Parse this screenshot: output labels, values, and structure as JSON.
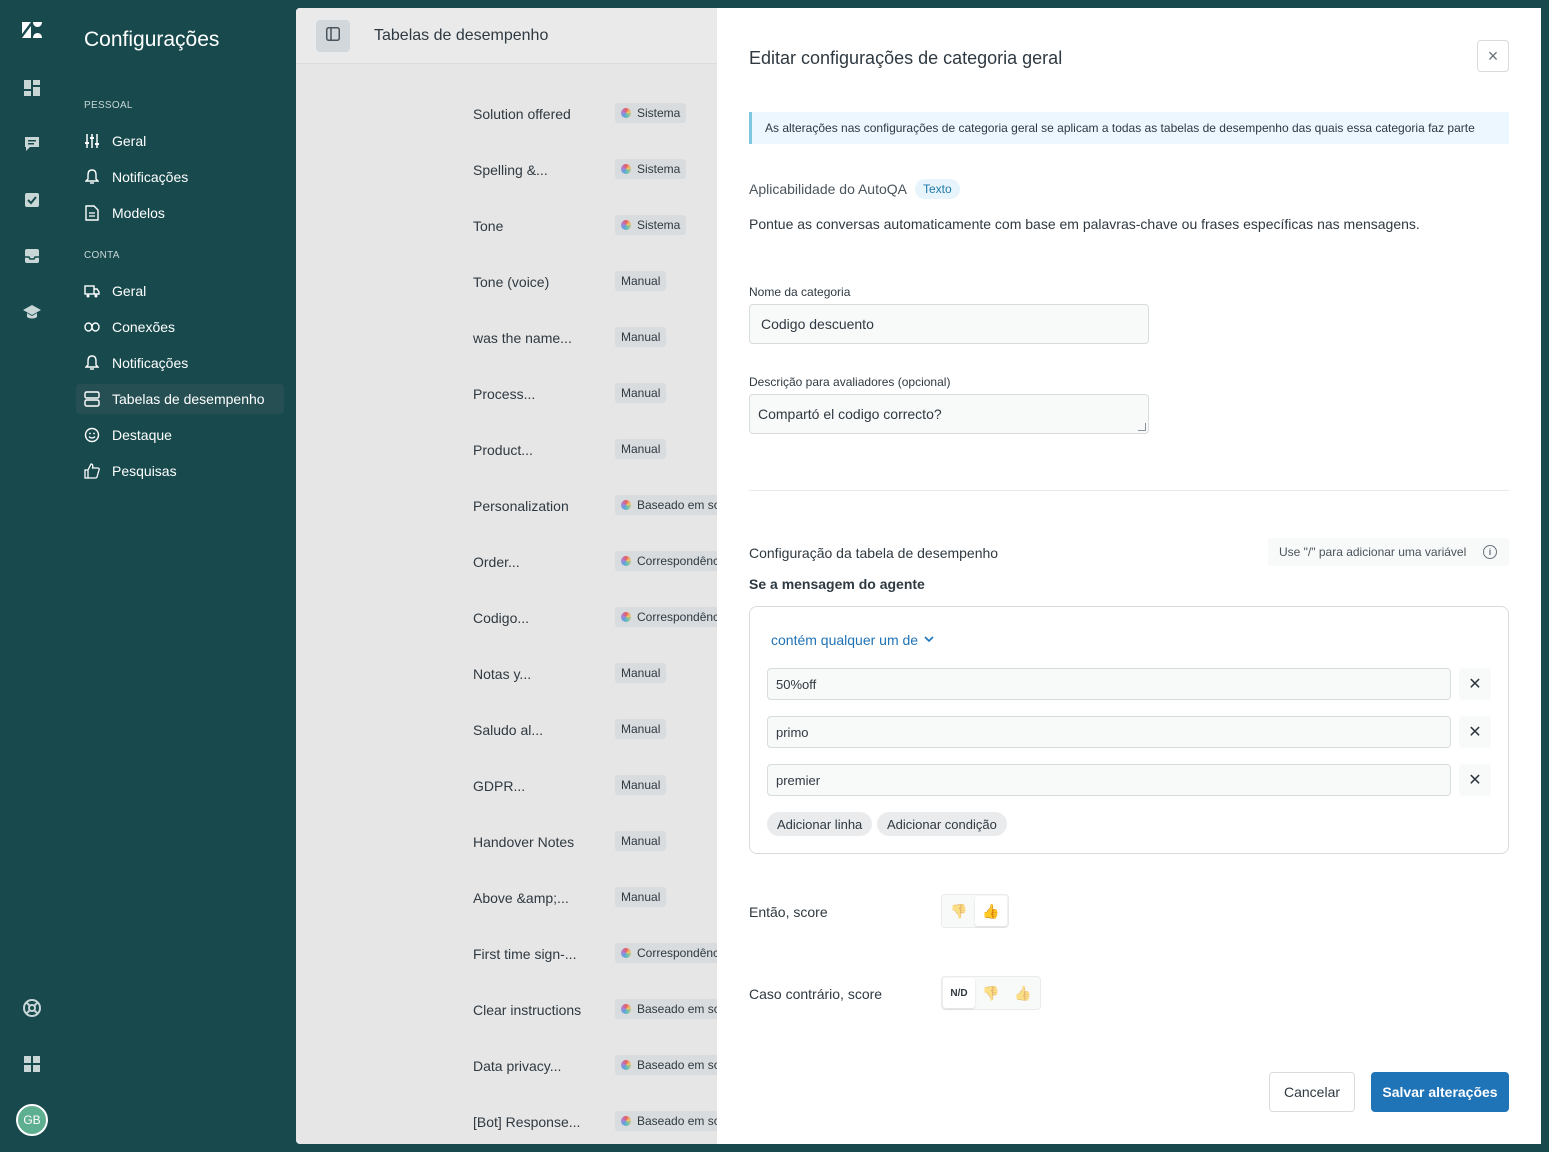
{
  "sidebar": {
    "title": "Configurações",
    "sections": [
      {
        "label": "PESSOAL",
        "items": [
          {
            "label": "Geral",
            "icon": "sliders-icon"
          },
          {
            "label": "Notificações",
            "icon": "bell-icon"
          },
          {
            "label": "Modelos",
            "icon": "document-icon"
          }
        ]
      },
      {
        "label": "CONTA",
        "items": [
          {
            "label": "Geral",
            "icon": "truck-icon"
          },
          {
            "label": "Conexões",
            "icon": "link-icon"
          },
          {
            "label": "Notificações",
            "icon": "bell-icon"
          },
          {
            "label": "Tabelas de desempenho",
            "icon": "table-icon",
            "active": true
          },
          {
            "label": "Destaque",
            "icon": "smile-icon"
          },
          {
            "label": "Pesquisas",
            "icon": "thumbs-up-icon"
          }
        ]
      }
    ]
  },
  "rail": {
    "avatar_initials": "GB"
  },
  "main": {
    "title": "Tabelas de desempenho",
    "rows": [
      {
        "name": "Solution offered",
        "badge": "Sistema",
        "ai": true
      },
      {
        "name": "Spelling &...",
        "badge": "Sistema",
        "ai": true
      },
      {
        "name": "Tone",
        "badge": "Sistema",
        "ai": true
      },
      {
        "name": "Tone (voice)",
        "badge": "Manual",
        "ai": false
      },
      {
        "name": "was the name...",
        "badge": "Manual",
        "ai": false
      },
      {
        "name": "Process...",
        "badge": "Manual",
        "ai": false
      },
      {
        "name": "Product...",
        "badge": "Manual",
        "ai": false
      },
      {
        "name": "Personalization",
        "badge": "Baseado em so",
        "ai": true
      },
      {
        "name": "Order...",
        "badge": "Correspondênc",
        "ai": true
      },
      {
        "name": "Codigo...",
        "badge": "Correspondênc",
        "ai": true
      },
      {
        "name": "Notas y...",
        "badge": "Manual",
        "ai": false
      },
      {
        "name": "Saludo al...",
        "badge": "Manual",
        "ai": false
      },
      {
        "name": "GDPR...",
        "badge": "Manual",
        "ai": false
      },
      {
        "name": "Handover Notes",
        "badge": "Manual",
        "ai": false
      },
      {
        "name": "Above &amp;...",
        "badge": "Manual",
        "ai": false
      },
      {
        "name": "First time sign-...",
        "badge": "Correspondênc",
        "ai": true
      },
      {
        "name": "Clear instructions",
        "badge": "Baseado em so",
        "ai": true
      },
      {
        "name": "Data privacy...",
        "badge": "Baseado em so",
        "ai": true
      },
      {
        "name": "[Bot] Response...",
        "badge": "Baseado em so",
        "ai": true
      }
    ]
  },
  "drawer": {
    "title": "Editar configurações de categoria geral",
    "notice": "As alterações nas configurações de categoria geral se aplicam a todas as tabelas de desempenho das quais essa categoria faz parte",
    "autoqa_label": "Aplicabilidade do AutoQA",
    "autoqa_tag": "Texto",
    "description": "Pontue as conversas automaticamente com base em palavras-chave ou frases específicas nas mensagens.",
    "name_label": "Nome da categoria",
    "name_value": "Codigo descuento",
    "desc_label": "Descrição para avaliadores (opcional)",
    "desc_value": "Compartó el codigo correcto?",
    "config_title": "Configuração da tabela de desempenho",
    "variable_hint": "Use \"/\" para adicionar uma variável",
    "condition_label": "Se a mensagem do agente",
    "operator": "contém qualquer um de",
    "keywords": [
      "50%off",
      "primo",
      "premier"
    ],
    "add_line": "Adicionar linha",
    "add_condition": "Adicionar condição",
    "then_label": "Então, score",
    "else_label": "Caso contrário, score",
    "na_label": "N/D",
    "cancel": "Cancelar",
    "save": "Salvar alterações"
  }
}
